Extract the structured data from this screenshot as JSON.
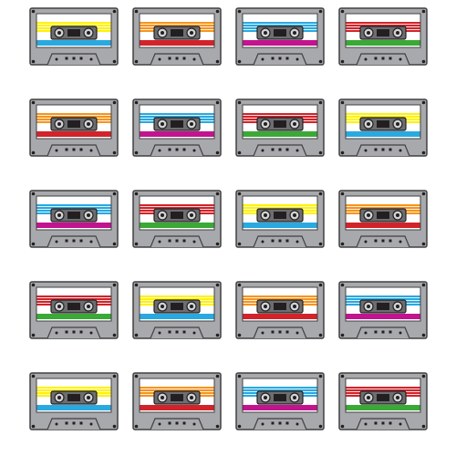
{
  "palettes": {
    "yellow": {
      "top": "#fff200",
      "mid": "#ffffff",
      "bottom": "#29a9e0"
    },
    "orange": {
      "top": "#f7941d",
      "mid": "#ffffff",
      "bottom": "#d2232a"
    },
    "blue": {
      "top": "#29a9e0",
      "mid": "#ffffff",
      "bottom": "#c2148e"
    },
    "red": {
      "top": "#d2232a",
      "mid": "#ffffff",
      "bottom": "#3aa935"
    }
  },
  "colors": {
    "body_fill": "#a7a9ac",
    "body_stroke": "#414042",
    "label_fill": "#ffffff",
    "window_fill": "#6d6e71",
    "dark": "#231f20",
    "reel": "#d1d3d4"
  },
  "cassettes": [
    {
      "palette": "yellow"
    },
    {
      "palette": "orange"
    },
    {
      "palette": "blue"
    },
    {
      "palette": "red"
    },
    {
      "palette": "orange"
    },
    {
      "palette": "blue"
    },
    {
      "palette": "red"
    },
    {
      "palette": "yellow"
    },
    {
      "palette": "blue"
    },
    {
      "palette": "red"
    },
    {
      "palette": "yellow"
    },
    {
      "palette": "orange"
    },
    {
      "palette": "red"
    },
    {
      "palette": "yellow"
    },
    {
      "palette": "orange"
    },
    {
      "palette": "blue"
    },
    {
      "palette": "yellow"
    },
    {
      "palette": "orange"
    },
    {
      "palette": "blue"
    },
    {
      "palette": "red"
    }
  ]
}
